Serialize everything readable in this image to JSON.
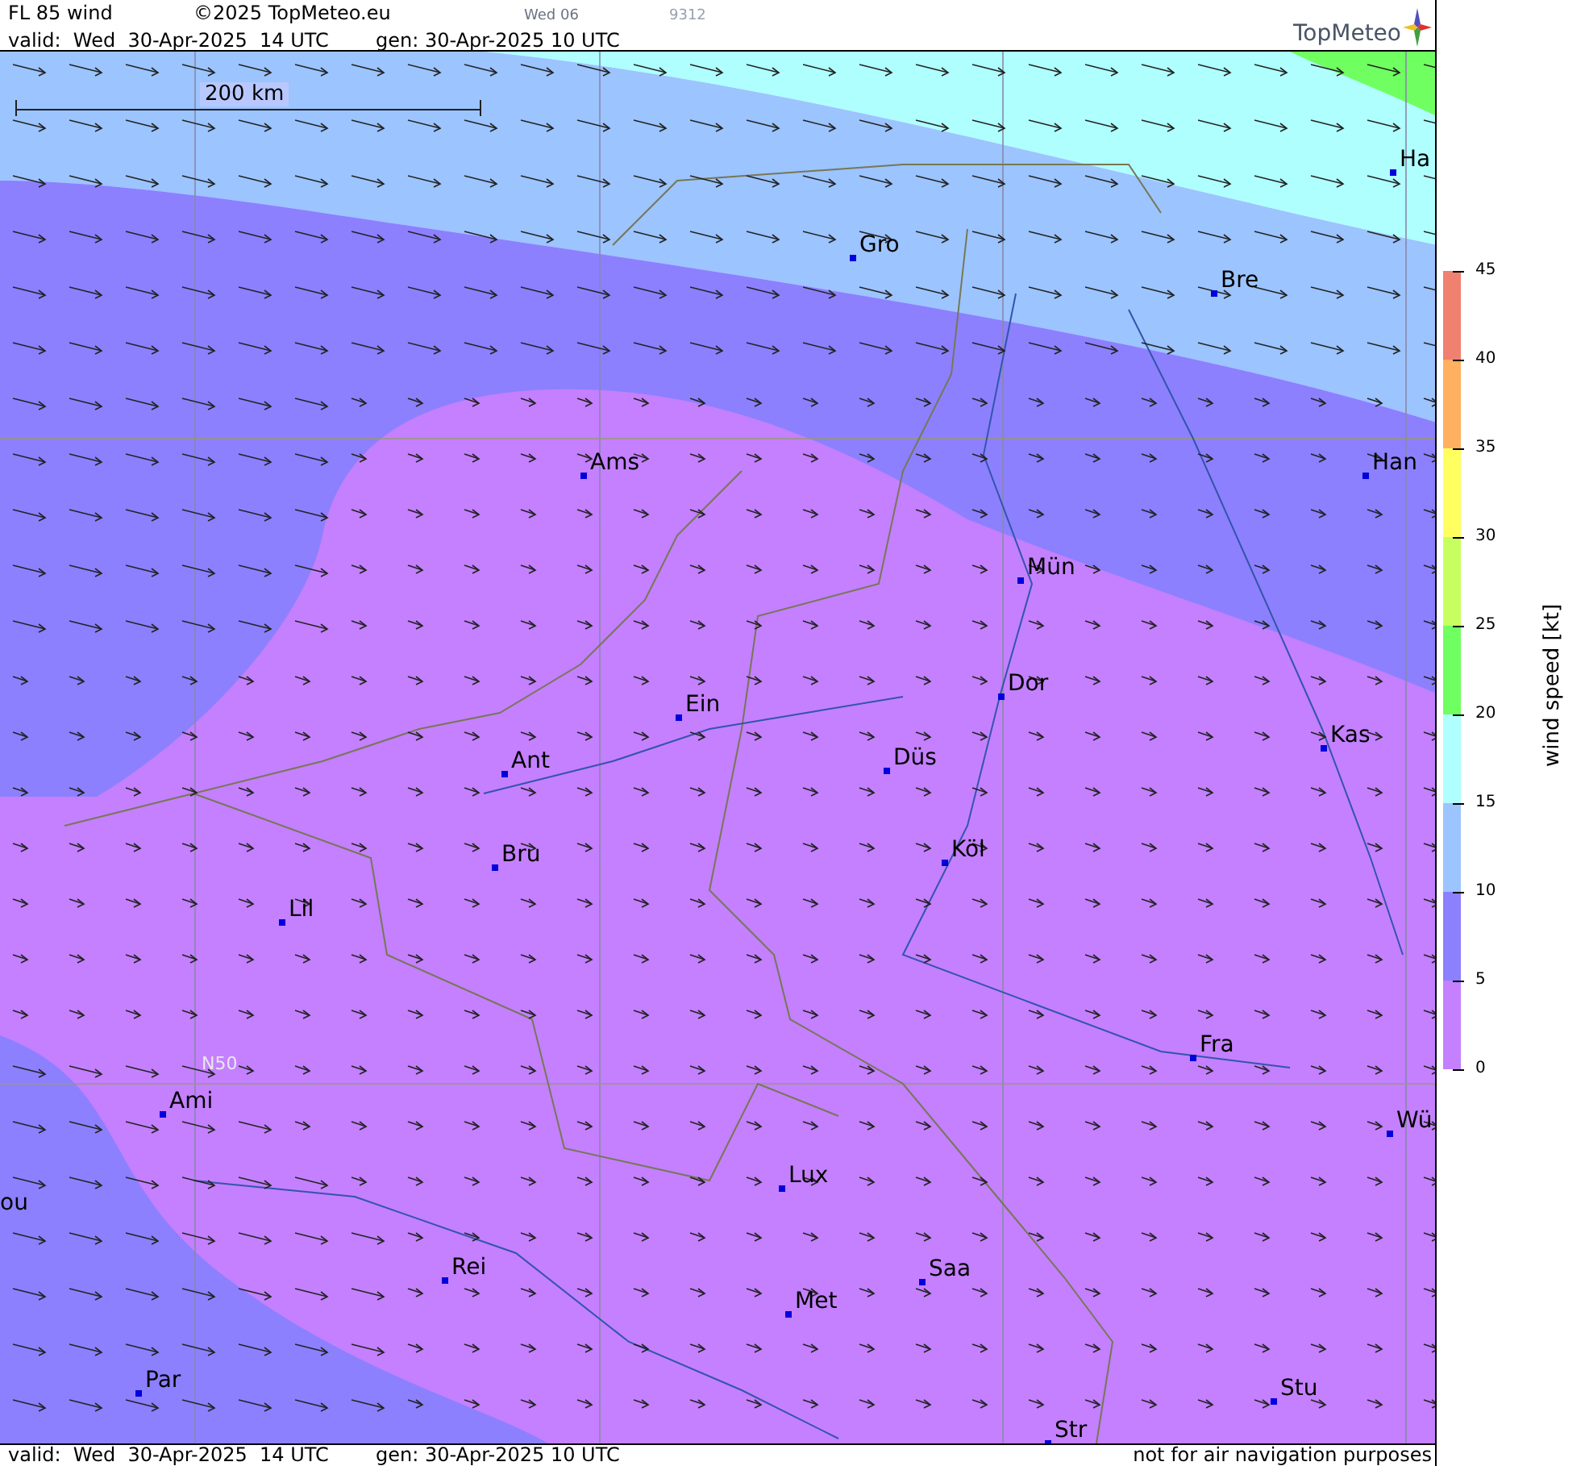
{
  "header": {
    "title": "FL 85 wind",
    "copyright": "©2025 TopMeteo.eu",
    "day_code": "Wed 06",
    "code": "9312",
    "valid": "valid:  Wed  30-Apr-2025  14 UTC",
    "gen": "gen: 30-Apr-2025 10 UTC",
    "logo": "TopMeteo"
  },
  "map": {
    "scale": "200 km",
    "grid_label": "N50",
    "cities": [
      {
        "name": "Ha"
      },
      {
        "name": "Gro"
      },
      {
        "name": "Bre"
      },
      {
        "name": "Ams"
      },
      {
        "name": "Han"
      },
      {
        "name": "Mün"
      },
      {
        "name": "Dor"
      },
      {
        "name": "Ein"
      },
      {
        "name": "Kas"
      },
      {
        "name": "Düs"
      },
      {
        "name": "Ant"
      },
      {
        "name": "Köl"
      },
      {
        "name": "Bru"
      },
      {
        "name": "Lil"
      },
      {
        "name": "Fra"
      },
      {
        "name": "Ami"
      },
      {
        "name": "Wü"
      },
      {
        "name": "Lux"
      },
      {
        "name": "ou"
      },
      {
        "name": "Rei"
      },
      {
        "name": "Saa"
      },
      {
        "name": "Met"
      },
      {
        "name": "Par"
      },
      {
        "name": "Stu"
      },
      {
        "name": "Str"
      }
    ]
  },
  "legend": {
    "title": "wind speed [kt]",
    "ticks": [
      "45",
      "40",
      "35",
      "30",
      "25",
      "20",
      "15",
      "10",
      "5",
      "0"
    ],
    "bands": [
      {
        "color": "#f08070"
      },
      {
        "color": "#ffb060"
      },
      {
        "color": "#ffff60"
      },
      {
        "color": "#c8ff60"
      },
      {
        "color": "#70ff60"
      },
      {
        "color": "#b0ffff"
      },
      {
        "color": "#9cc4ff"
      },
      {
        "color": "#8c80ff"
      },
      {
        "color": "#c480ff"
      }
    ]
  },
  "footer": {
    "valid": "valid:  Wed  30-Apr-2025  14 UTC",
    "gen": "gen: 30-Apr-2025 10 UTC",
    "disclaimer": "not for air navigation purposes"
  }
}
